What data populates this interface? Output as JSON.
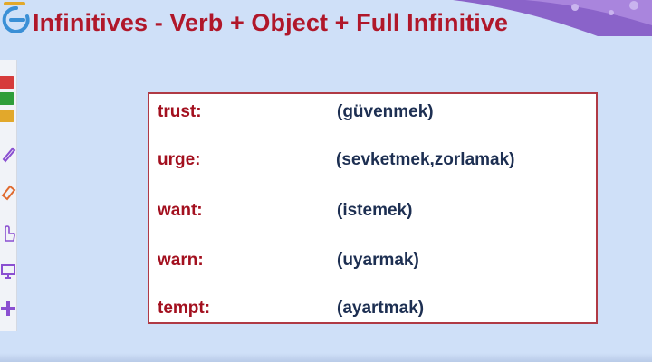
{
  "slide": {
    "title": "Infinitives - Verb + Object + Full Infinitive"
  },
  "vocabulary": [
    {
      "word": "trust:",
      "meaning": "(güvenmek)"
    },
    {
      "word": "urge:",
      "meaning": "(sevketmek,zorlamak)"
    },
    {
      "word": "want:",
      "meaning": "(istemek)"
    },
    {
      "word": "warn:",
      "meaning": "(uyarmak)"
    },
    {
      "word": "tempt:",
      "meaning": "(ayartmak)"
    }
  ],
  "toolbar": {
    "colors": [
      "#d63b3b",
      "#2f9e3a",
      "#e2a82b"
    ],
    "tools": [
      "pen-icon",
      "eraser-icon",
      "pointer-hand-icon",
      "screen-icon",
      "add-icon"
    ]
  },
  "colors": {
    "title": "#b0172a",
    "word": "#a3101f",
    "meaning": "#1d2f52",
    "background": "#cfe0f8",
    "card_border": "#b03a45"
  }
}
